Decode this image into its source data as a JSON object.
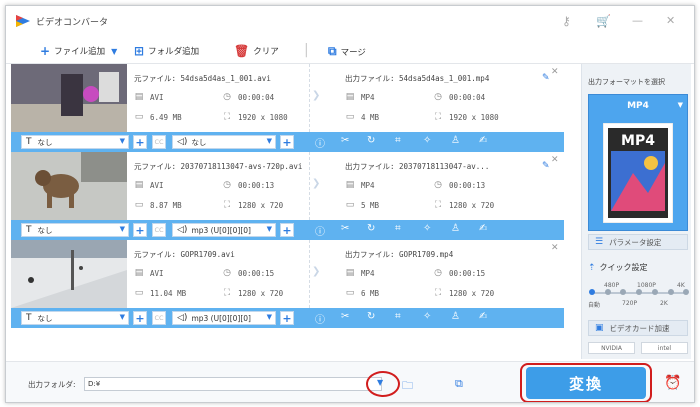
{
  "app": {
    "title": "ビデオコンバータ"
  },
  "toolbar": {
    "add_file": "ファイル追加",
    "add_folder": "フォルダ追加",
    "clear": "クリア",
    "merge": "マージ"
  },
  "items": [
    {
      "src": {
        "name": "元ファイル: 54dsa5d4as_1_001.avi",
        "format": "AVI",
        "duration": "00:00:04",
        "size": "6.49 MB",
        "resolution": "1920 x 1080"
      },
      "out": {
        "name": "出力ファイル: 54dsa5d4as_1_001.mp4",
        "format": "MP4",
        "duration": "00:00:04",
        "size": "4 MB",
        "resolution": "1920 x 1080"
      },
      "subtitle": "なし",
      "audio": "なし"
    },
    {
      "src": {
        "name": "元ファイル: 20370718113047-avs-720p.avi",
        "format": "AVI",
        "duration": "00:00:13",
        "size": "8.87 MB",
        "resolution": "1280 x 720"
      },
      "out": {
        "name": "出力ファイル: 20370718113047-av...",
        "format": "MP4",
        "duration": "00:00:13",
        "size": "5 MB",
        "resolution": "1280 x 720"
      },
      "subtitle": "なし",
      "audio": "mp3 (U[0][0][0]"
    },
    {
      "src": {
        "name": "元ファイル: GOPR1709.avi",
        "format": "AVI",
        "duration": "00:00:15",
        "size": "11.04 MB",
        "resolution": "1280 x 720"
      },
      "out": {
        "name": "出力ファイル: GOPR1709.mp4",
        "format": "MP4",
        "duration": "00:00:15",
        "size": "6 MB",
        "resolution": "1280 x 720"
      },
      "subtitle": "なし",
      "audio": "mp3 (U[0][0][0]"
    }
  ],
  "right_panel": {
    "title": "出力フォーマットを選択",
    "format": "MP4",
    "format_icon_text": "MP4",
    "param_label": "パラメータ設定",
    "quick_label": "クイック設定",
    "slider_top": [
      "480P",
      "1080P",
      "4K"
    ],
    "slider_bottom": [
      "自動",
      "720P",
      "2K"
    ],
    "quick_selected_fraction": 0,
    "gpu_label": "ビデオカード加速",
    "gpu_chips": [
      "NVIDIA",
      "intel"
    ]
  },
  "bottom": {
    "output_label": "出力フォルダ:",
    "output_path": "D:¥",
    "convert_label": "変換"
  },
  "colors": {
    "accent": "#2f7ce0",
    "bar": "#5fb2f0",
    "convert": "#3d9de8",
    "highlight": "#d11d1d"
  }
}
